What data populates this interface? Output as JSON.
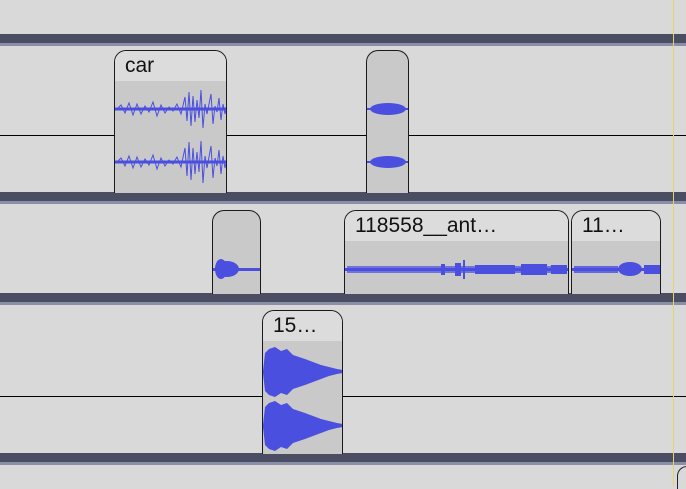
{
  "clips": [
    {
      "id": "car",
      "title": "car"
    },
    {
      "id": "clip-2",
      "title": ""
    },
    {
      "id": "clip-3",
      "title": ""
    },
    {
      "id": "clip-118558",
      "title": "118558__ant…"
    },
    {
      "id": "clip-11",
      "title": "11…"
    },
    {
      "id": "clip-15",
      "title": "15…"
    }
  ],
  "colors": {
    "waveform": "#4a4fe0",
    "clip_body": "#c9c9c9",
    "clip_title_bg": "#dcdcdc",
    "track_separator": "#4b4e62",
    "background": "#d9d9d9"
  }
}
